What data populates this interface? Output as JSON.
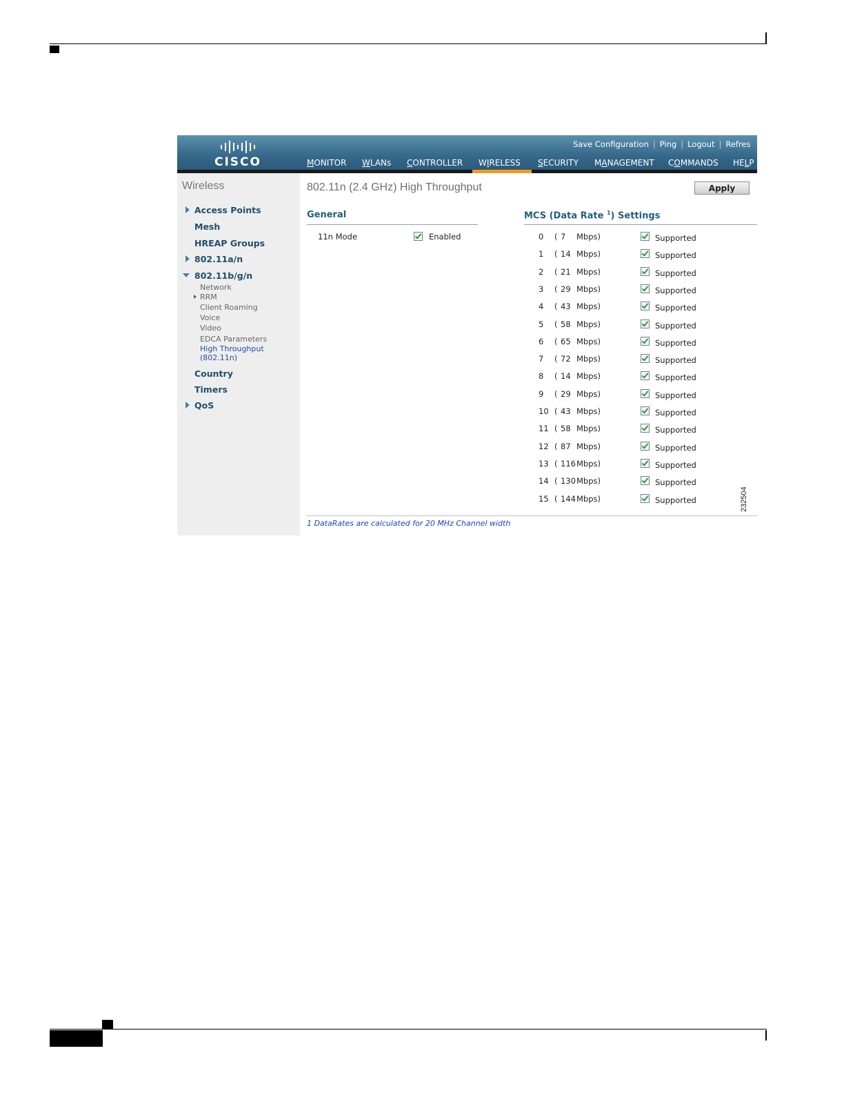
{
  "header": {
    "logo_text": "CISCO",
    "top_links": [
      "Save Configuration",
      "Ping",
      "Logout",
      "Refres"
    ],
    "nav": [
      {
        "label": "MONITOR",
        "u": "M"
      },
      {
        "label": "WLANs",
        "u": "W"
      },
      {
        "label": "CONTROLLER",
        "u": "C"
      },
      {
        "label": "WIRELESS",
        "u": "I"
      },
      {
        "label": "SECURITY",
        "u": "S"
      },
      {
        "label": "MANAGEMENT",
        "u": "A"
      },
      {
        "label": "COMMANDS",
        "u": "O"
      },
      {
        "label": "HELP",
        "u": "L"
      }
    ],
    "active_nav": "WIRELESS",
    "accent_color": "#f39a1f"
  },
  "sidebar": {
    "title": "Wireless",
    "items": [
      "Access Points",
      "Mesh",
      "HREAP Groups",
      "802.11a/n",
      "802.11b/g/n",
      "Country",
      "Timers",
      "QoS"
    ],
    "sub_items": [
      "Network",
      "RRM",
      "Client Roaming",
      "Voice",
      "Video",
      "EDCA Parameters",
      "High Throughput",
      "(802.11n)"
    ]
  },
  "main": {
    "title": "802.11n (2.4 GHz) High Throughput",
    "apply_label": "Apply",
    "general": {
      "title": "General",
      "mode_label": "11n Mode",
      "mode_value": "Enabled",
      "mode_checked": true
    },
    "mcs": {
      "title": "MCS (Data Rate ",
      "footnote_marker": "1",
      "title_suffix": ") Settings",
      "rows": [
        {
          "idx": "0",
          "rate": "7",
          "unit": "Mbps)",
          "status": "Supported"
        },
        {
          "idx": "1",
          "rate": "14",
          "unit": "Mbps)",
          "status": "Supported"
        },
        {
          "idx": "2",
          "rate": "21",
          "unit": "Mbps)",
          "status": "Supported"
        },
        {
          "idx": "3",
          "rate": "29",
          "unit": "Mbps)",
          "status": "Supported"
        },
        {
          "idx": "4",
          "rate": "43",
          "unit": "Mbps)",
          "status": "Supported"
        },
        {
          "idx": "5",
          "rate": "58",
          "unit": "Mbps)",
          "status": "Supported"
        },
        {
          "idx": "6",
          "rate": "65",
          "unit": "Mbps)",
          "status": "Supported"
        },
        {
          "idx": "7",
          "rate": "72",
          "unit": "Mbps)",
          "status": "Supported"
        },
        {
          "idx": "8",
          "rate": "14",
          "unit": "Mbps)",
          "status": "Supported"
        },
        {
          "idx": "9",
          "rate": "29",
          "unit": "Mbps)",
          "status": "Supported"
        },
        {
          "idx": "10",
          "rate": "43",
          "unit": "Mbps)",
          "status": "Supported"
        },
        {
          "idx": "11",
          "rate": "58",
          "unit": "Mbps)",
          "status": "Supported"
        },
        {
          "idx": "12",
          "rate": "87",
          "unit": "Mbps)",
          "status": "Supported"
        },
        {
          "idx": "13",
          "rate": "116",
          "unit": "Mbps)",
          "status": "Supported"
        },
        {
          "idx": "14",
          "rate": "130",
          "unit": "Mbps)",
          "status": "Supported"
        },
        {
          "idx": "15",
          "rate": "144",
          "unit": "Mbps)",
          "status": "Supported"
        }
      ]
    },
    "footnote": "1 DataRates are calculated for 20 MHz Channel width",
    "figure_id": "232504"
  }
}
